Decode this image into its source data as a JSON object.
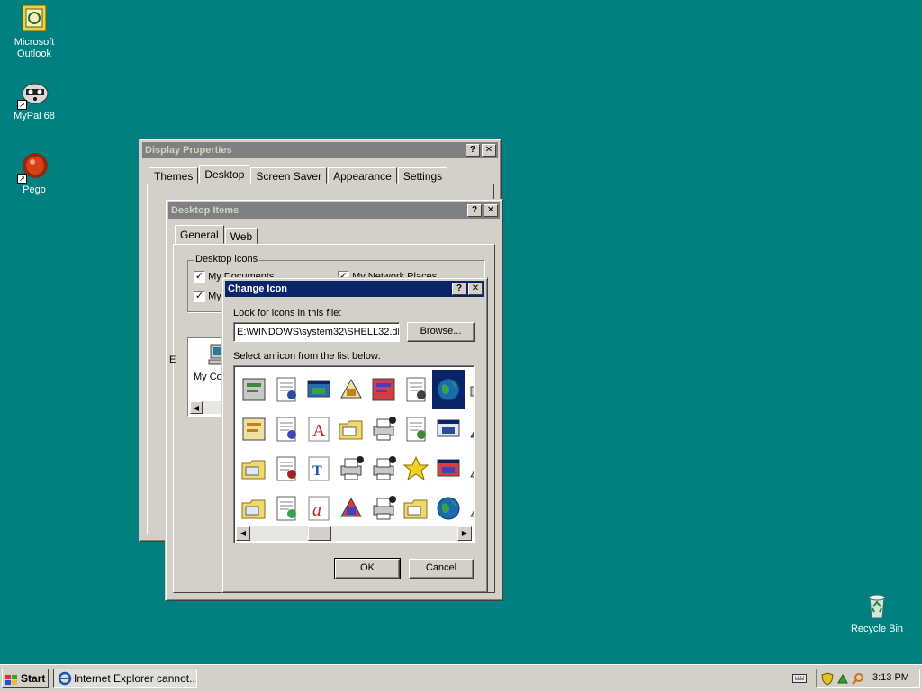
{
  "desktop": {
    "icons": [
      {
        "label_line1": "Microsoft",
        "label_line2": "Outlook",
        "icon": "outlook-icon"
      },
      {
        "label_line1": "MyPal 68",
        "label_line2": "",
        "icon": "raccoon-icon"
      },
      {
        "label_line1": "Pego",
        "label_line2": "",
        "icon": "pego-icon"
      },
      {
        "label_line1": "Recycle Bin",
        "label_line2": "",
        "icon": "recycle-bin-icon"
      }
    ]
  },
  "display_properties": {
    "title": "Display Properties",
    "tabs": [
      "Themes",
      "Desktop",
      "Screen Saver",
      "Appearance",
      "Settings"
    ],
    "selected_tab": "Desktop"
  },
  "desktop_items": {
    "title": "Desktop Items",
    "tabs": [
      "General",
      "Web"
    ],
    "selected_tab": "General",
    "group_label": "Desktop icons",
    "checkboxes": [
      {
        "label": "My Documents",
        "checked": true
      },
      {
        "label": "My Network Places",
        "checked": true
      },
      {
        "label": "My",
        "checked": true
      }
    ],
    "preview_label": "My Co",
    "partial_label": "E"
  },
  "change_icon": {
    "title": "Change Icon",
    "look_label": "Look for icons in this file:",
    "file_value": "E:\\WINDOWS\\system32\\SHELL32.dll",
    "browse_label": "Browse...",
    "select_label": "Select an icon from the list below:",
    "ok_label": "OK",
    "cancel_label": "Cancel",
    "icons": [
      "recycle-full-icon",
      "gear-document-icon",
      "install-icon",
      "window-run-icon",
      "components-icon",
      "tree-icon",
      "globe-network-icon",
      "printer-partial-icon",
      "documents-icon",
      "find-document-icon",
      "font-icon",
      "folder-error-icon",
      "printer-check-icon",
      "network-share-icon",
      "control-panel-icon",
      "monitor-partial-icon",
      "folder-open-icon",
      "notepad-icon",
      "truetype-icon",
      "printer-network-icon",
      "printer-shared-icon",
      "star-icon",
      "settings-window-icon",
      "window-partial-icon",
      "folder-tree-icon",
      "program-gear-icon",
      "opentype-icon",
      "cd-drive-icon",
      "fax-printer-icon",
      "folder-arrow-icon",
      "globe-frame-icon",
      "floppy-partial-icon"
    ],
    "selected_index": 6
  },
  "taskbar": {
    "start_label": "Start",
    "task_label": "Internet Explorer cannot...",
    "clock": "3:13 PM"
  },
  "colors": {
    "desktop": "#008080",
    "active_title": "#0a246a",
    "inactive_title": "#808080"
  }
}
